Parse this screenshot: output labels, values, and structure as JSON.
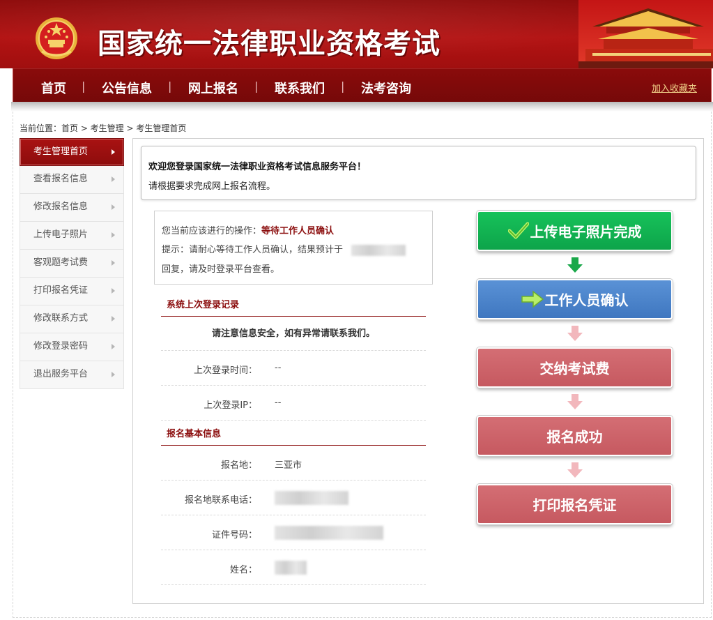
{
  "header": {
    "site_title": "国家统一法律职业资格考试"
  },
  "nav": {
    "items": [
      "首页",
      "公告信息",
      "网上报名",
      "联系我们",
      "法考咨询"
    ],
    "separator": "|",
    "favorite": "加入收藏夹"
  },
  "breadcrumb": "当前位置：首页 > 考生管理 > 考生管理首页",
  "sidebar": {
    "items": [
      "考生管理首页",
      "查看报名信息",
      "修改报名信息",
      "上传电子照片",
      "客观题考试费",
      "打印报名凭证",
      "修改联系方式",
      "修改登录密码",
      "退出服务平台"
    ],
    "active_index": 0
  },
  "welcome": {
    "line1": "欢迎您登录国家统一法律职业资格考试信息服务平台！",
    "line2": "请根据要求完成网上报名流程。"
  },
  "operation": {
    "label": "您当前应该进行的操作：",
    "value": "等待工作人员确认",
    "hint_prefix": "提示：请耐心等待工作人员确认，结果预计于",
    "hint_suffix": "回复，请及时登录平台查看。"
  },
  "login_record": {
    "title": "系统上次登录记录",
    "notice": "请注意信息安全，如有异常请联系我们。",
    "rows": [
      {
        "label": "上次登录时间：",
        "value": "--"
      },
      {
        "label": "上次登录IP：",
        "value": "--"
      }
    ]
  },
  "basic_info": {
    "title": "报名基本信息",
    "rows": [
      {
        "label": "报名地：",
        "value": "三亚市"
      },
      {
        "label": "报名地联系电话：",
        "value": ""
      },
      {
        "label": "证件号码：",
        "value": ""
      },
      {
        "label": "姓名：",
        "value": ""
      }
    ]
  },
  "steps": [
    {
      "label": "上传电子照片完成",
      "status": "done",
      "icon": "check-icon"
    },
    {
      "label": "工作人员确认",
      "status": "current",
      "icon": "arrow-right-icon"
    },
    {
      "label": "交纳考试费",
      "status": "pending",
      "icon": ""
    },
    {
      "label": "报名成功",
      "status": "pending",
      "icon": ""
    },
    {
      "label": "打印报名凭证",
      "status": "pending",
      "icon": ""
    }
  ],
  "colors": {
    "brand_red": "#a61010",
    "step_done": "#12b552",
    "step_current": "#4a83ca",
    "step_pending": "#cc636a",
    "arrow_active": "#1aa84a",
    "arrow_pending": "#f2b7bc"
  }
}
